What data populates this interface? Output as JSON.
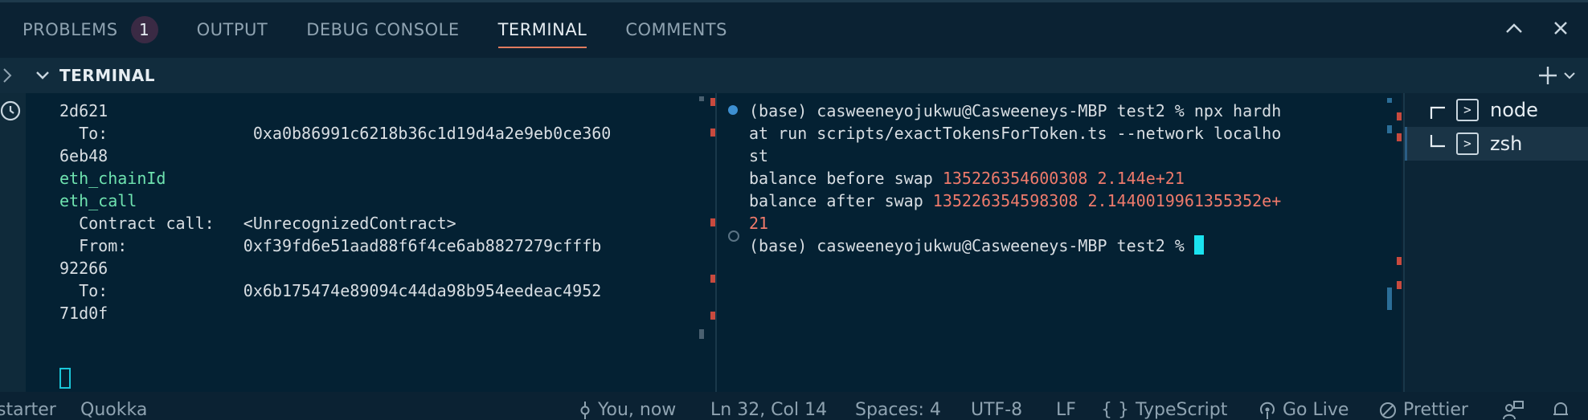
{
  "panel": {
    "tabs": [
      {
        "label": "PROBLEMS",
        "badge": "1"
      },
      {
        "label": "OUTPUT"
      },
      {
        "label": "DEBUG CONSOLE"
      },
      {
        "label": "TERMINAL",
        "active": true
      },
      {
        "label": "COMMENTS"
      }
    ]
  },
  "section": {
    "title": "TERMINAL"
  },
  "left_terminal": {
    "lines": [
      "2d621",
      "  To:               0xa0b86991c6218b36c1d19d4a2e9eb0ce360",
      "6eb48",
      "",
      "eth_chainId",
      "eth_call",
      "  Contract call:   <UnrecognizedContract>",
      "  From:            0xf39fd6e51aad88f6f4ce6ab8827279cfffb",
      "92266",
      "  To:              0x6b175474e89094c44da98b954eedeac4952",
      "71d0f"
    ]
  },
  "right_terminal": {
    "cmd1_line1": "(base) casweeneyojukwu@Casweeneys-MBP test2 % npx hardh",
    "cmd1_line2": "at run scripts/exactTokensForToken.ts --network localho",
    "cmd1_line3": "st",
    "before_label": "balance before swap ",
    "before_values": "135226354600308 2.144e+21",
    "after_label": "balance after swap ",
    "after_values_1": "135226354598308 2.1440019961355352e+",
    "after_values_2": "21",
    "prompt2": "(base) casweeneyojukwu@Casweeneys-MBP test2 % "
  },
  "terminal_list": [
    {
      "label": "node"
    },
    {
      "label": "zsh",
      "selected": true
    }
  ],
  "statusbar": {
    "left1": "starter",
    "left2": "Quokka",
    "blame": "You, now",
    "position": "Ln 32, Col 14",
    "spaces": "Spaces: 4",
    "encoding": "UTF-8",
    "eol": "LF",
    "language": "TypeScript",
    "golive": "Go Live",
    "prettier": "Prettier"
  },
  "colors": {
    "accent": "#e07b5f",
    "error": "#ef7a6b",
    "keyword": "#6fe3b0",
    "cursor": "#1ae3f0"
  }
}
